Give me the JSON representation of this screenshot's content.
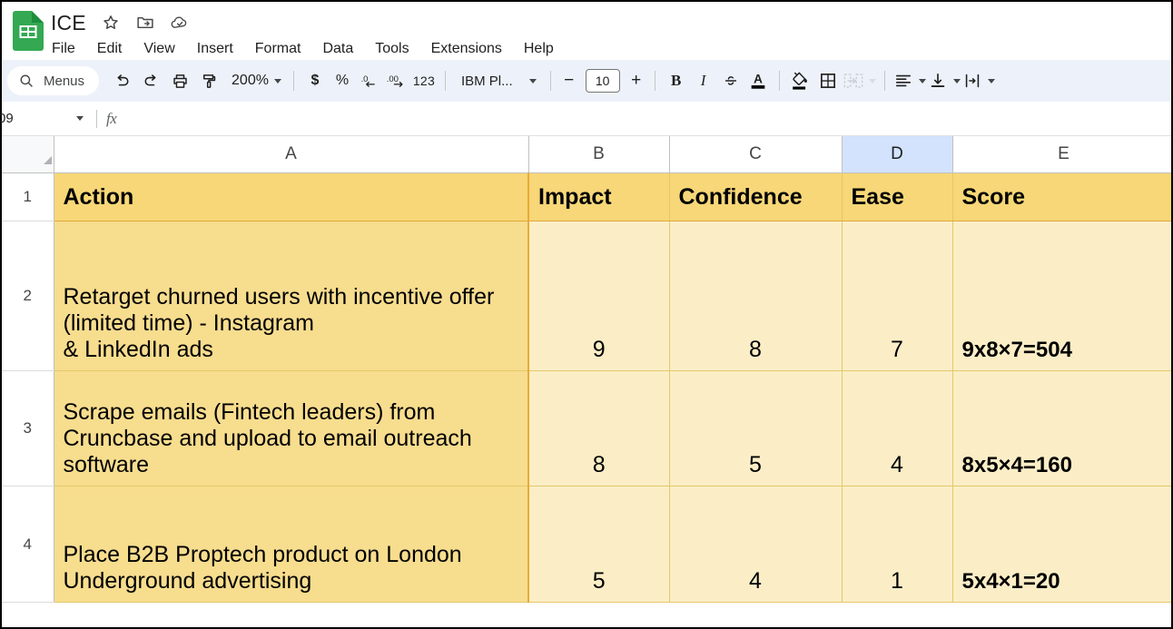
{
  "app": {
    "doc_title": "ICE",
    "title_icons": [
      "star-icon",
      "move-to-folder-icon",
      "cloud-saved-icon"
    ],
    "menus": [
      "File",
      "Edit",
      "View",
      "Insert",
      "Format",
      "Data",
      "Tools",
      "Extensions",
      "Help"
    ]
  },
  "toolbar": {
    "search_placeholder": "Menus",
    "undo_label": "Undo",
    "redo_label": "Redo",
    "print_label": "Print",
    "paint_label": "Paint format",
    "zoom_value": "200%",
    "currency_label": "$",
    "percent_label": "%",
    "decrease_decimal_label": ".0",
    "increase_decimal_label": ".00",
    "number_format_label": "123",
    "font_name": "IBM Pl...",
    "font_size": "10",
    "decrease_size_label": "−",
    "increase_size_label": "+",
    "bold_label": "B",
    "italic_label": "I",
    "strikethrough_label": "strikethrough-icon",
    "text_color_label": "A",
    "fill_color_label": "fill-color-icon",
    "borders_label": "borders-icon",
    "merge_label": "merge-cells-icon",
    "h_align_label": "horizontal-align-icon",
    "v_align_label": "vertical-align-icon",
    "wrap_label": "text-wrap-icon"
  },
  "formula_bar": {
    "name_box_value": "09",
    "fx_label": "fx",
    "formula_value": ""
  },
  "grid": {
    "columns": [
      "A",
      "B",
      "C",
      "D",
      "E"
    ],
    "selected_column": "D",
    "row_numbers": [
      "1",
      "2",
      "3",
      "4"
    ],
    "header_row": {
      "action": "Action",
      "impact": "Impact",
      "confidence": "Confidence",
      "ease": "Ease",
      "score": "Score"
    },
    "rows": [
      {
        "row": "2",
        "action": "Retarget churned users with incentive offer (limited time) - Instagram\n& LinkedIn ads",
        "impact": "9",
        "confidence": "8",
        "ease": "7",
        "score": "9x8×7=504"
      },
      {
        "row": "3",
        "action": "Scrape emails (Fintech leaders) from Cruncbase and upload to email outreach software",
        "impact": "8",
        "confidence": "5",
        "ease": "4",
        "score": "8x5×4=160"
      },
      {
        "row": "4",
        "action": "Place B2B Proptech product on London\nUnderground advertising",
        "impact": "5",
        "confidence": "4",
        "ease": "1",
        "score": "5x4×1=20"
      }
    ]
  },
  "colors": {
    "sheets_green": "#34a853",
    "header_fill": "#f7d777",
    "action_fill": "#f7dd8e",
    "value_fill": "#fbeec6",
    "selection_blue": "#d3e3fd",
    "toolbar_bg": "#edf2fa"
  }
}
